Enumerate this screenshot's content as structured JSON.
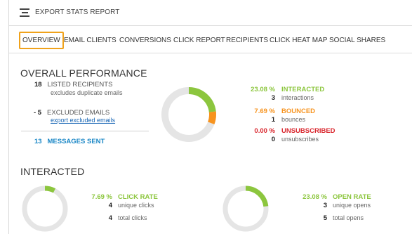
{
  "header": {
    "title": "EXPORT STATS REPORT",
    "icon": "report-icon"
  },
  "tabs": [
    {
      "label": "OVERVIEW",
      "active": true
    },
    {
      "label": "EMAIL CLIENTS",
      "active": false
    },
    {
      "label": "CONVERSIONS",
      "active": false
    },
    {
      "label": "CLICK REPORT",
      "active": false
    },
    {
      "label": "RECIPIENTS",
      "active": false
    },
    {
      "label": "CLICK HEAT MAP",
      "active": false
    },
    {
      "label": "SOCIAL SHARES",
      "active": false
    }
  ],
  "colors": {
    "accent_tab": "#f0a21b",
    "interacted": "#8cc63e",
    "bounced": "#f7931e",
    "unsubscribed": "#d9262d",
    "link": "#1a67b5",
    "sent": "#1a87c6",
    "donut_track": "#e5e5e5"
  },
  "overall": {
    "heading": "OVERALL PERFORMANCE",
    "listed": {
      "value": "18",
      "label": "LISTED RECIPIENTS",
      "sub": "excludes duplicate emails"
    },
    "excluded": {
      "value": "- 5",
      "label": "EXCLUDED EMAILS",
      "link": "export excluded emails"
    },
    "sent": {
      "value": "13",
      "label": "MESSAGES SENT"
    },
    "legend": {
      "interacted": {
        "pct": "23.08 %",
        "label": "INTERACTED",
        "count": "3",
        "unit": "interactions",
        "fraction": 0.2308
      },
      "bounced": {
        "pct": "7.69 %",
        "label": "BOUNCED",
        "count": "1",
        "unit": "bounces",
        "fraction": 0.0769
      },
      "unsubscribed": {
        "pct": "0.00 %",
        "label": "UNSUBSCRIBED",
        "count": "0",
        "unit": "unsubscribes",
        "fraction": 0.0
      }
    }
  },
  "interacted": {
    "heading": "INTERACTED",
    "click_rate": {
      "pct": "7.69 %",
      "label": "CLICK RATE",
      "unique_count": "4",
      "unique_label": "unique clicks",
      "total_count": "4",
      "total_label": "total clicks",
      "fraction": 0.0769
    },
    "open_rate": {
      "pct": "23.08 %",
      "label": "OPEN RATE",
      "unique_count": "3",
      "unique_label": "unique opens",
      "total_count": "5",
      "total_label": "total opens",
      "fraction": 0.2308
    }
  }
}
